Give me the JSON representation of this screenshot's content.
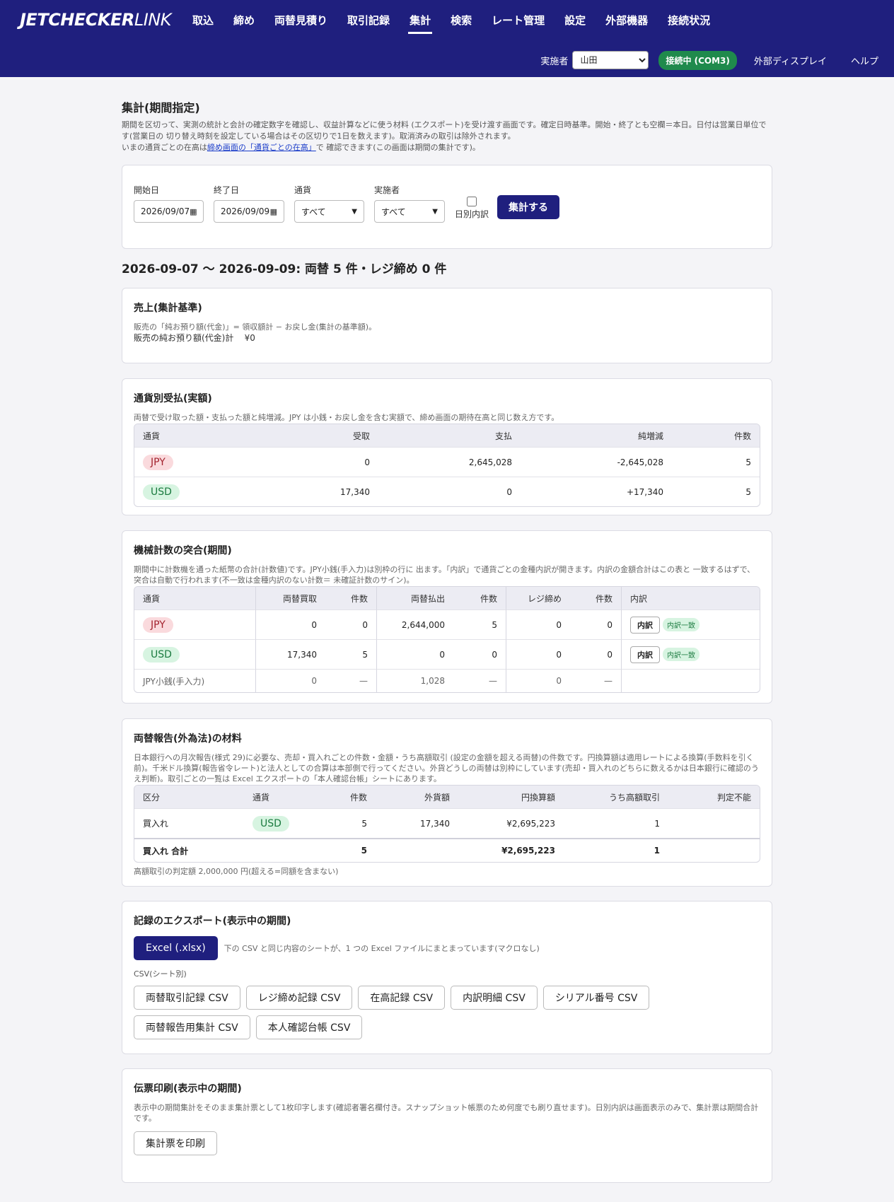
{
  "header": {
    "logo_bold": "JETCHECKER",
    "logo_light": "LINK",
    "nav": [
      "取込",
      "締め",
      "両替見積り",
      "取引記録",
      "集計",
      "検索",
      "レート管理",
      "設定",
      "外部機器",
      "接続状況"
    ],
    "active_nav": "集計",
    "operator_label": "実施者",
    "operator_value": "山田",
    "connection": "接続中 (COM3)",
    "external_display": "外部ディスプレイ",
    "help": "ヘルプ"
  },
  "page": {
    "title": "集計(期間指定)",
    "desc1": "期間を区切って、実測の統計と会計の確定数字を確認し、収益計算などに使う材料 (エクスポート)を受け渡す画面です。確定日時基準。開始・終了とも空欄＝本日。日付は営業日単位です(営業日の 切り替え時刻を設定している場合はその区切りで1日を数えます)。取消済みの取引は除外されます。",
    "desc2_pre": "いまの通貨ごとの在高は",
    "desc2_link": "締め画面の「通貨ごとの在高」",
    "desc2_post": "で 確認できます(この画面は期間の集計です)。"
  },
  "filter": {
    "start_label": "開始日",
    "start_value": "2026/09/07",
    "end_label": "終了日",
    "end_value": "2026/09/09",
    "currency_label": "通貨",
    "currency_value": "すべて",
    "operator_label": "実施者",
    "operator_value": "すべて",
    "daily_label": "日別内訳",
    "submit": "集計する"
  },
  "period_summary": "2026-09-07 〜 2026-09-09: 両替 5 件・レジ締め 0 件",
  "sales": {
    "title": "売上(集計基準)",
    "note": "販売の「純お預り額(代金)」= 領収額計 − お戻し金(集計の基準額)。",
    "line_label": "販売の純お預り額(代金)計",
    "line_value": "¥0"
  },
  "flows": {
    "title": "通貨別受払(実額)",
    "note": "両替で受け取った額・支払った額と純増減。JPY は小銭・お戻し金を含む実額で、締め画面の期待在高と同じ数え方です。",
    "headers": [
      "通貨",
      "受取",
      "支払",
      "純増減",
      "件数"
    ],
    "rows": [
      {
        "currency": "JPY",
        "received": "0",
        "paid": "2,645,028",
        "net": "-2,645,028",
        "count": "5"
      },
      {
        "currency": "USD",
        "received": "17,340",
        "paid": "0",
        "net": "+17,340",
        "count": "5"
      }
    ]
  },
  "machine": {
    "title": "機械計数の突合(期間)",
    "note": "期間中に計数機を通った紙幣の合計(計数値)です。JPY小銭(手入力)は別枠の行に 出ます。「内訳」で通貨ごとの金種内訳が開きます。内訳の金額合計はこの表と 一致するはずで、突合は自動で行われます(不一致は金種内訳のない計数＝ 未確証計数のサイン)。",
    "headers": [
      "通貨",
      "両替買取",
      "件数",
      "両替払出",
      "件数",
      "レジ締め",
      "件数",
      "内訳"
    ],
    "rows": [
      {
        "currency": "JPY",
        "buy": "0",
        "buy_n": "0",
        "pay": "2,644,000",
        "pay_n": "5",
        "close": "0",
        "close_n": "0",
        "detail": "内訳",
        "status": "内訳一致"
      },
      {
        "currency": "USD",
        "buy": "17,340",
        "buy_n": "5",
        "pay": "0",
        "pay_n": "0",
        "close": "0",
        "close_n": "0",
        "detail": "内訳",
        "status": "内訳一致"
      }
    ],
    "coin_row": {
      "label": "JPY小銭(手入力)",
      "buy": "0",
      "buy_n": "—",
      "pay": "1,028",
      "pay_n": "—",
      "close": "0",
      "close_n": "—"
    }
  },
  "report": {
    "title": "両替報告(外為法)の材料",
    "note": "日本銀行への月次報告(様式 29)に必要な、売却・買入れごとの件数・金額・うち高額取引 (設定の金額を超える両替)の件数です。円換算額は適用レートによる換算(手数料を引く前)。千米ドル換算(報告省令レート)と法人としての合算は本部側で行ってください。外貨どうしの両替は別枠にしています(売却・買入れのどちらに数えるかは日本銀行に確認のうえ判断)。取引ごとの一覧は Excel エクスポートの「本人確認台帳」シートにあります。",
    "headers": [
      "区分",
      "通貨",
      "件数",
      "外貨額",
      "円換算額",
      "うち高額取引",
      "判定不能"
    ],
    "row": {
      "kind": "買入れ",
      "currency": "USD",
      "count": "5",
      "fx": "17,340",
      "jpy": "¥2,695,223",
      "high": "1",
      "unknown": ""
    },
    "total": {
      "label": "買入れ 合計",
      "count": "5",
      "jpy": "¥2,695,223",
      "high": "1"
    },
    "footnote": "高額取引の判定額 2,000,000 円(超える=同額を含まない)"
  },
  "export": {
    "title": "記録のエクスポート(表示中の期間)",
    "excel": "Excel (.xlsx)",
    "excel_note": "下の CSV と同じ内容のシートが、1 つの Excel ファイルにまとまっています(マクロなし)",
    "csv_label": "CSV(シート別)",
    "csv_buttons": [
      "両替取引記録 CSV",
      "レジ締め記録 CSV",
      "在高記録 CSV",
      "内訳明細 CSV",
      "シリアル番号 CSV",
      "両替報告用集計 CSV",
      "本人確認台帳 CSV"
    ]
  },
  "print": {
    "title": "伝票印刷(表示中の期間)",
    "note": "表示中の期間集計をそのまま集計票として1枚印字します(確認者署名欄付き。スナップショット帳票のため何度でも刷り直せます)。日別内訳は画面表示のみで、集計票は期間合計です。",
    "button": "集計票を印刷"
  }
}
